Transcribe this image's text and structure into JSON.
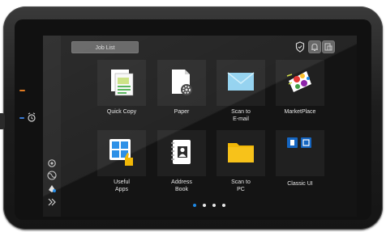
{
  "header": {
    "job_list_label": "Job List"
  },
  "apps": [
    {
      "label": "Quick Copy",
      "icon": "copy-document-icon"
    },
    {
      "label": "Paper",
      "icon": "paper-settings-icon"
    },
    {
      "label": "Scan to\nE-mail",
      "icon": "envelope-icon"
    },
    {
      "label": "MarketPlace",
      "icon": "marketplace-splash-icon"
    },
    {
      "label": "Useful\nApps",
      "icon": "apps-grid-thumb-icon"
    },
    {
      "label": "Address\nBook",
      "icon": "address-book-icon"
    },
    {
      "label": "Scan to\nPC",
      "icon": "folder-icon"
    },
    {
      "label": "Classic UI",
      "icon": "classic-ui-icon"
    }
  ],
  "pagination": {
    "pages": 4,
    "current": 1
  },
  "colors": {
    "power_led": "#e07a22",
    "status_led": "#3a7bd5",
    "active_dot": "#1e88e5",
    "folder": "#f2b807",
    "envelope": "#8ed0ef"
  }
}
